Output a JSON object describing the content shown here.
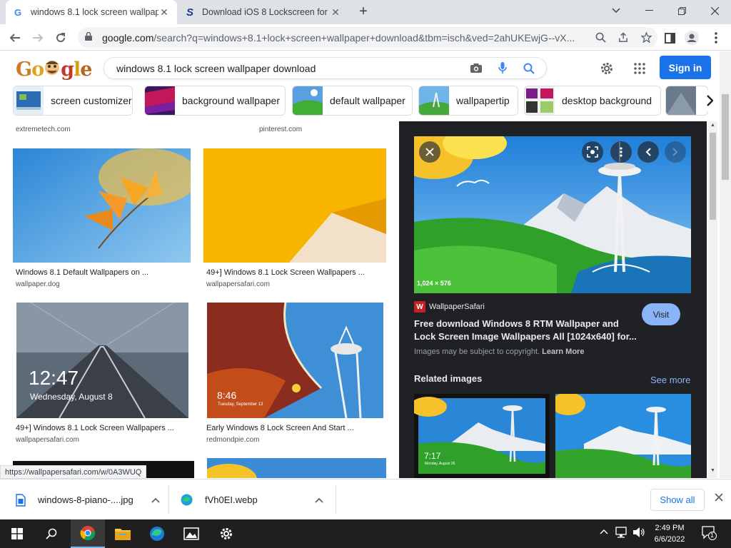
{
  "browser": {
    "tabs": [
      {
        "title": "windows 8.1 lock screen wallpap",
        "favicon": "google-icon",
        "active": true
      },
      {
        "title": "Download iOS 8 Lockscreen for V",
        "favicon": "s-logo-icon",
        "active": false
      }
    ],
    "url_host": "google.com",
    "url_path": "/search?q=windows+8.1+lock+screen+wallpaper+download&tbm=isch&ved=2ahUKEwjG--vX..."
  },
  "google": {
    "logo_text": "Goggle",
    "query": "windows 8.1 lock screen wallpaper download",
    "signin_label": "Sign in"
  },
  "chips": [
    {
      "label": "screen customizer"
    },
    {
      "label": "background wallpaper"
    },
    {
      "label": "default wallpaper"
    },
    {
      "label": "wallpapertip"
    },
    {
      "label": "desktop background"
    }
  ],
  "results": {
    "top_sources": [
      "extremetech.com",
      "pinterest.com"
    ],
    "items": [
      {
        "caption": "Windows 8.1 Default Wallpapers on ...",
        "site": "wallpaper.dog"
      },
      {
        "caption": "49+] Windows 8.1 Lock Screen Wallpapers ...",
        "site": "wallpapersafari.com"
      },
      {
        "caption": "49+] Windows 8.1 Lock Screen Wallpapers ...",
        "site": "wallpapersafari.com",
        "time_text": "12:47",
        "date_text": "Wednesday, August 8"
      },
      {
        "caption": "Early Windows 8 Lock Screen And Start ...",
        "site": "redmondpie.com",
        "time_text": "8:46",
        "date_text": "Tuesday, September 13"
      }
    ]
  },
  "preview": {
    "dimensions": "1,024 × 576",
    "source": "WallpaperSafari",
    "title": "Free download Windows 8 RTM Wallpaper and Lock Screen Image Wallpapers All [1024x640] for...",
    "visit_label": "Visit",
    "copyright_text": "Images may be subject to copyright.",
    "learn_more": "Learn More",
    "related_label": "Related images",
    "see_more": "See more",
    "related_thumb_time": "7:17",
    "related_thumb_date": "Monday, August 26"
  },
  "status_link": "https://wallpapersafari.com/w/0A3WUQ",
  "downloads": {
    "items": [
      {
        "name": "windows-8-piano-....jpg"
      },
      {
        "name": "fVh0EI.webp"
      }
    ],
    "show_all": "Show all"
  },
  "taskbar": {
    "time": "2:49 PM",
    "date": "6/6/2022",
    "notification_count": "1"
  },
  "colors": {
    "accent": "#1a73e8",
    "panel_bg": "#202124",
    "visit_btn": "#8ab4f8",
    "taskbar_bg": "#1f1f1f"
  }
}
